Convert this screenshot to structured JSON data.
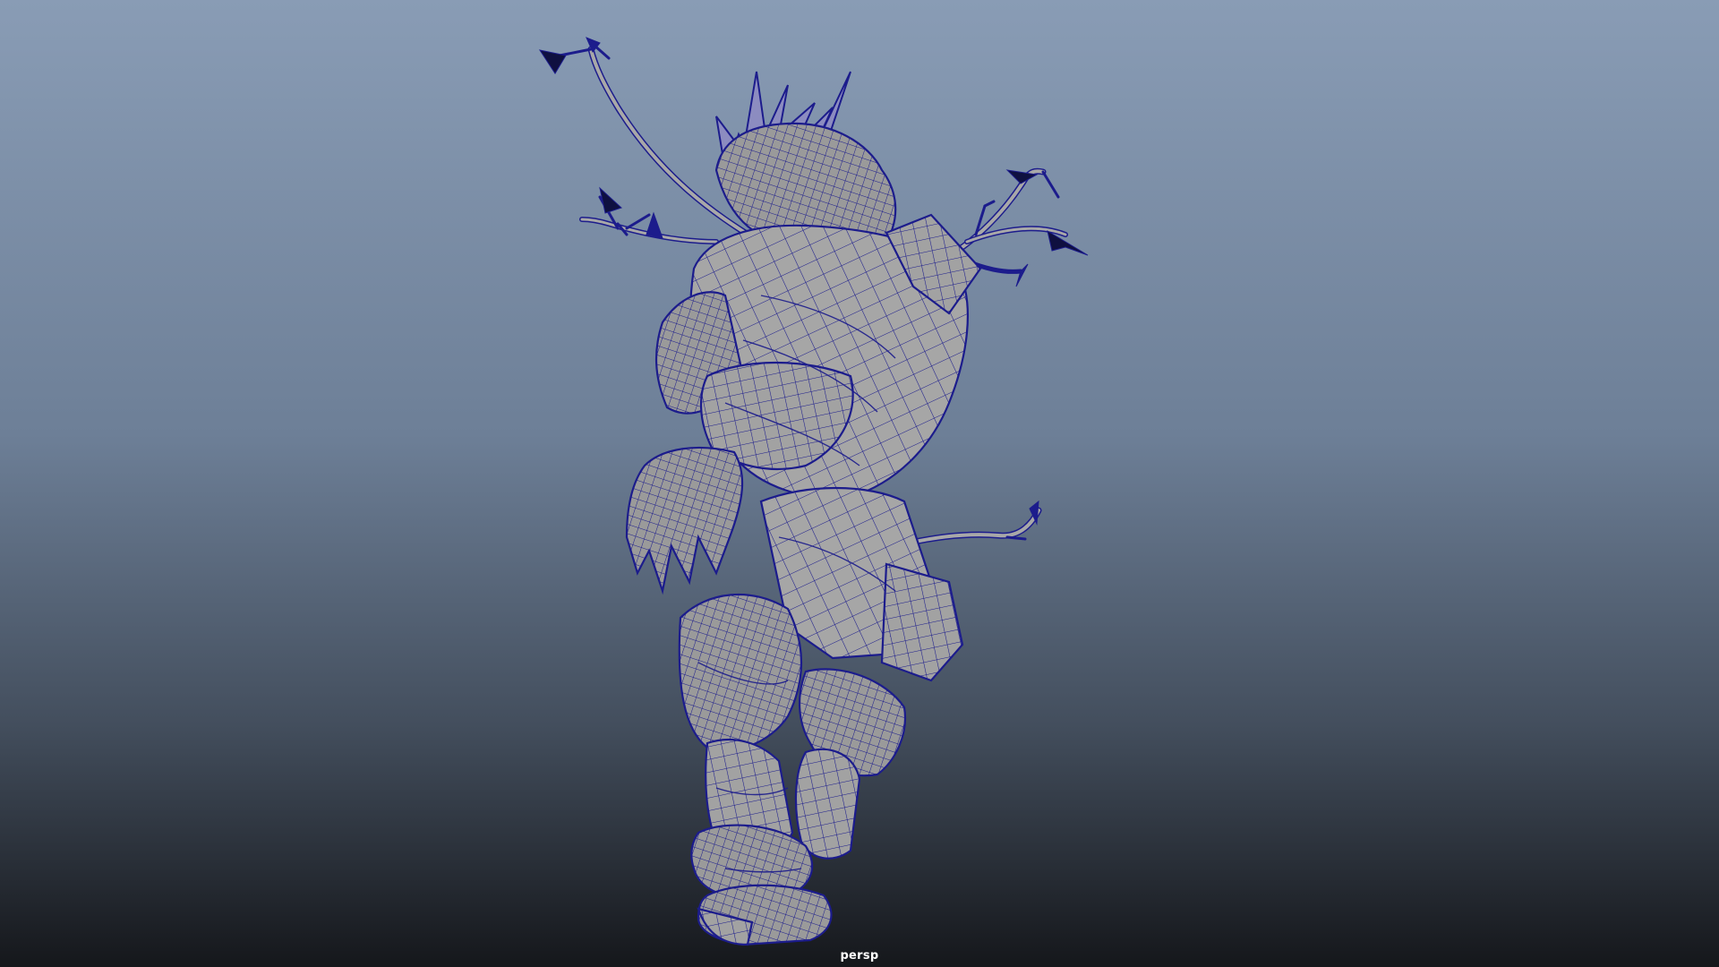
{
  "viewport": {
    "camera_name": "persp",
    "background_top_color": "#8a9cb6",
    "background_bottom_color": "#16181c",
    "mesh_fill_color": "#9c9c9c",
    "wireframe_color": "#1c1c8c",
    "leaf_color": "#0f1040",
    "subject": "character-wireframe-model"
  }
}
